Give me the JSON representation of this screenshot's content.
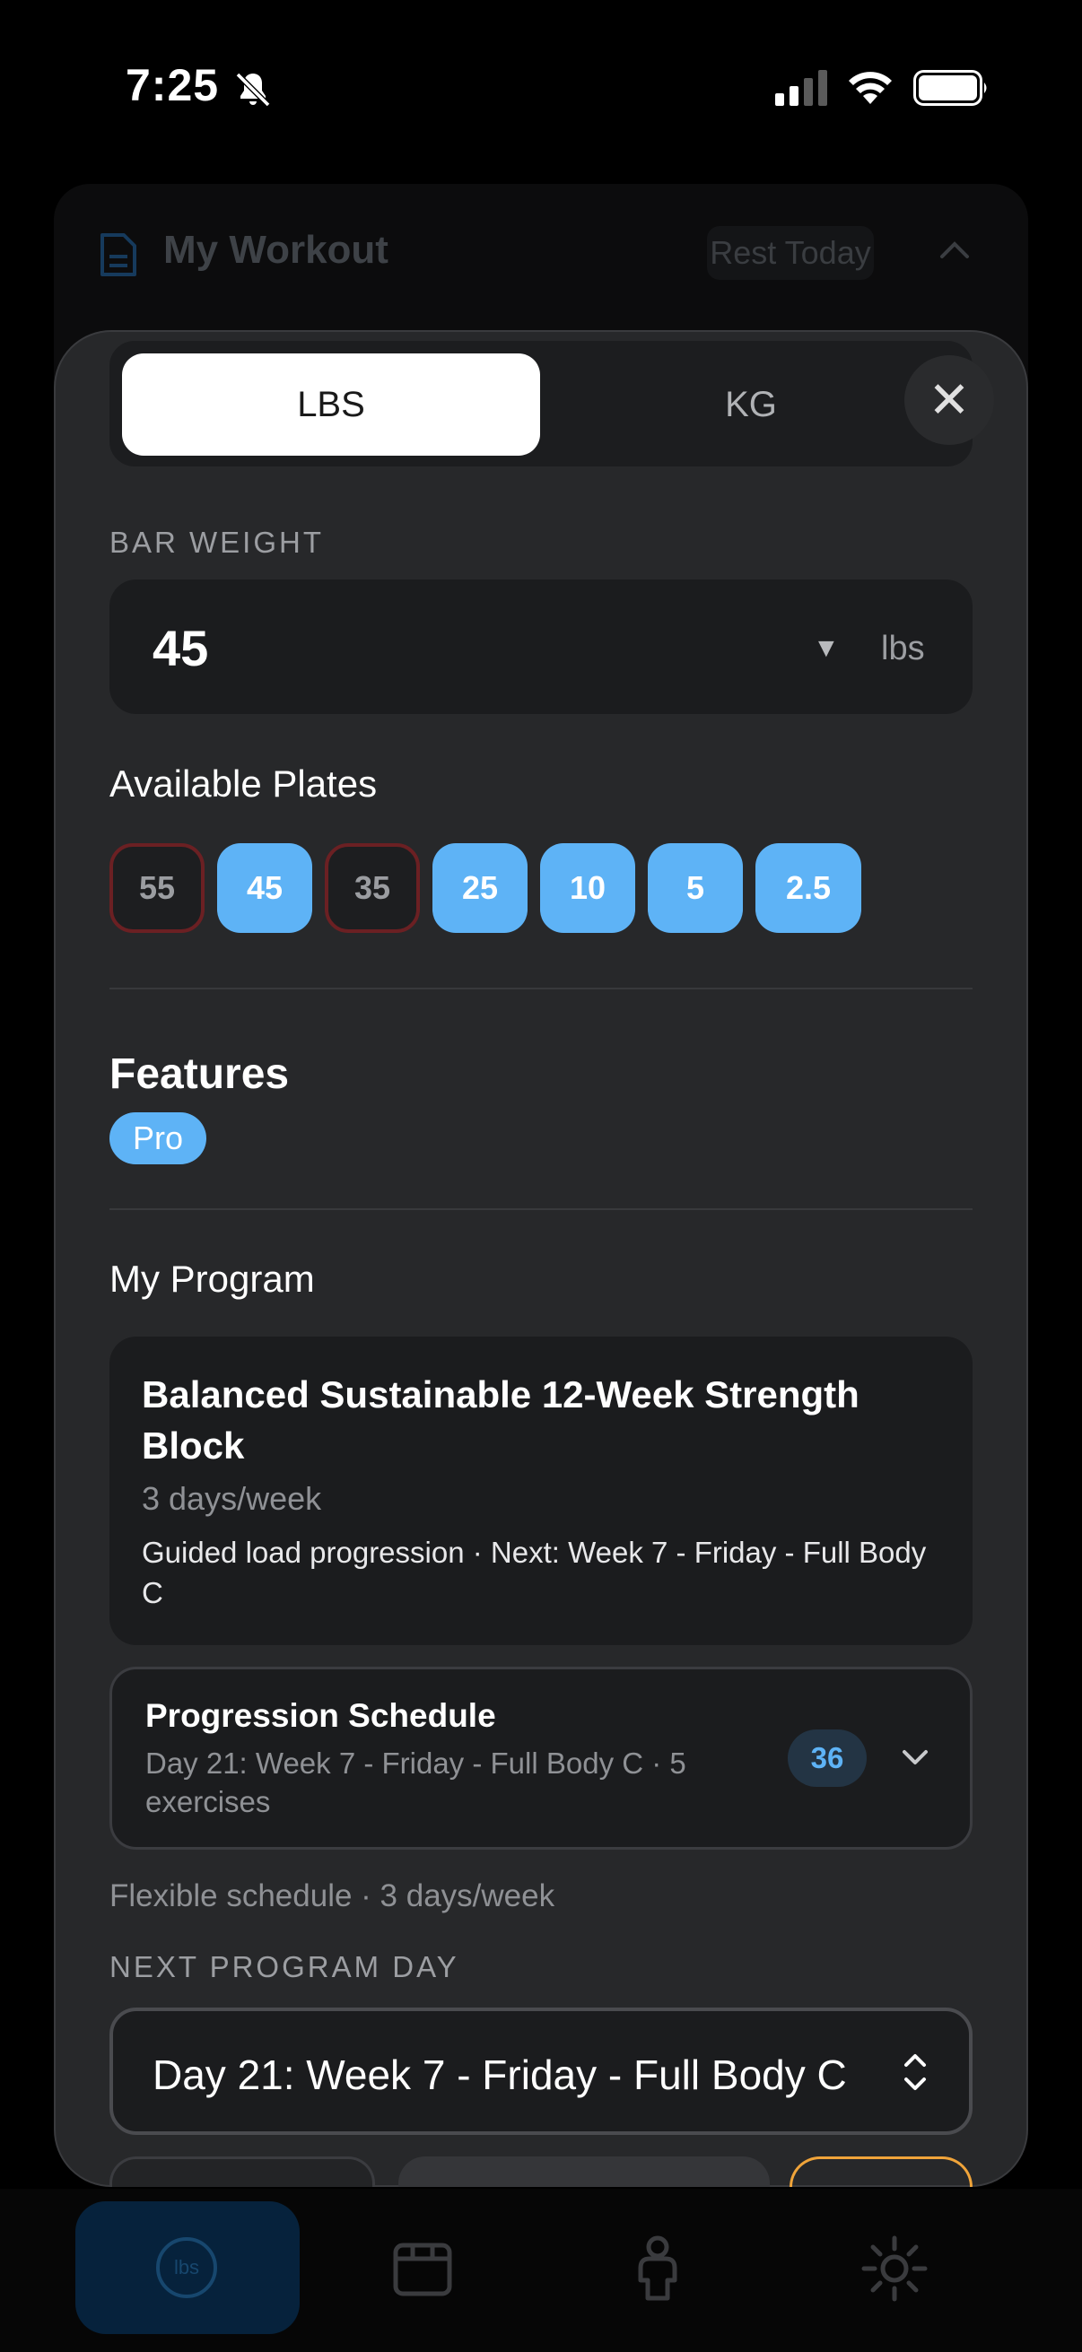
{
  "status_bar": {
    "time": "7:25",
    "icons": [
      "bell-slash-icon",
      "cellular-signal-icon",
      "wifi-icon",
      "battery-icon"
    ]
  },
  "background_card": {
    "title": "My Workout",
    "badge": "Rest Today",
    "icons": [
      "document-icon",
      "chevron-up-icon"
    ]
  },
  "unit_toggle": {
    "options": [
      "LBS",
      "KG"
    ],
    "selected": "LBS",
    "close_symbol": "✕"
  },
  "bar_weight": {
    "label": "BAR WEIGHT",
    "value": "45",
    "arrow": "▼",
    "unit": "lbs"
  },
  "plates": {
    "title": "Available Plates",
    "items": [
      {
        "value": "55",
        "enabled": false
      },
      {
        "value": "45",
        "enabled": true
      },
      {
        "value": "35",
        "enabled": false
      },
      {
        "value": "25",
        "enabled": true
      },
      {
        "value": "10",
        "enabled": true
      },
      {
        "value": "5",
        "enabled": true
      },
      {
        "value": "2.5",
        "enabled": true
      }
    ]
  },
  "features": {
    "title": "Features",
    "badge": "Pro"
  },
  "program": {
    "section_title": "My Program",
    "name": "Balanced Sustainable 12-Week Strength Block",
    "frequency": "3 days/week",
    "guided": "Guided load progression · Next: Week 7 - Friday - Full Body C"
  },
  "schedule": {
    "title": "Progression Schedule",
    "subtitle": "Day 21: Week 7 - Friday - Full Body C · 5 exercises",
    "count": "36"
  },
  "flex_schedule": "Flexible schedule · 3 days/week",
  "next_day": {
    "label": "NEXT PROGRAM DAY",
    "value": "Day 21: Week 7 - Friday - Full Body C"
  },
  "tab_bar": {
    "tabs": [
      {
        "icon": "plate-calculator-icon",
        "label": "lbs",
        "active": true
      },
      {
        "icon": "calendar-icon",
        "active": false
      },
      {
        "icon": "person-icon",
        "active": false
      },
      {
        "icon": "sun-icon",
        "active": false
      }
    ]
  },
  "colors": {
    "accent": "#5eb3f6",
    "disabled_border": "#6b2023",
    "sheet_bg": "#27282a",
    "peek_orange": "#f0a43a"
  }
}
